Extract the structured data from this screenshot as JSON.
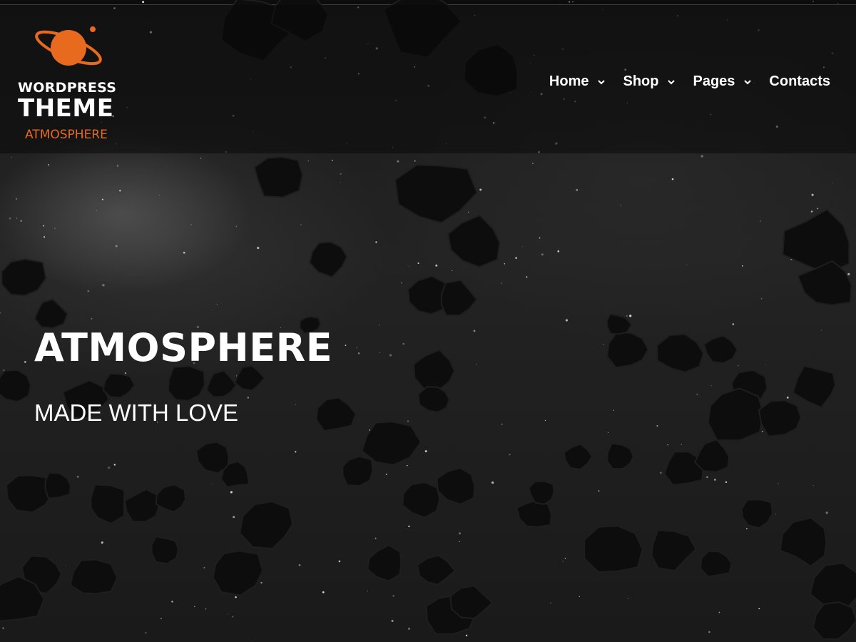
{
  "logo": {
    "line1": "WORDPRESS",
    "line2": "THEME",
    "line3": "ATMOSPHERE",
    "icon": "planet-icon",
    "accent_color": "#e86a1f"
  },
  "nav": {
    "items": [
      {
        "label": "Home",
        "has_dropdown": true
      },
      {
        "label": "Shop",
        "has_dropdown": true
      },
      {
        "label": "Pages",
        "has_dropdown": true
      },
      {
        "label": "Contacts",
        "has_dropdown": false
      }
    ],
    "dropdown_icon": "chevron-down-icon"
  },
  "hero": {
    "title": "ATMOSPHERE",
    "subtitle": "MADE WITH LOVE",
    "background": "asteroid-field-space-image"
  }
}
